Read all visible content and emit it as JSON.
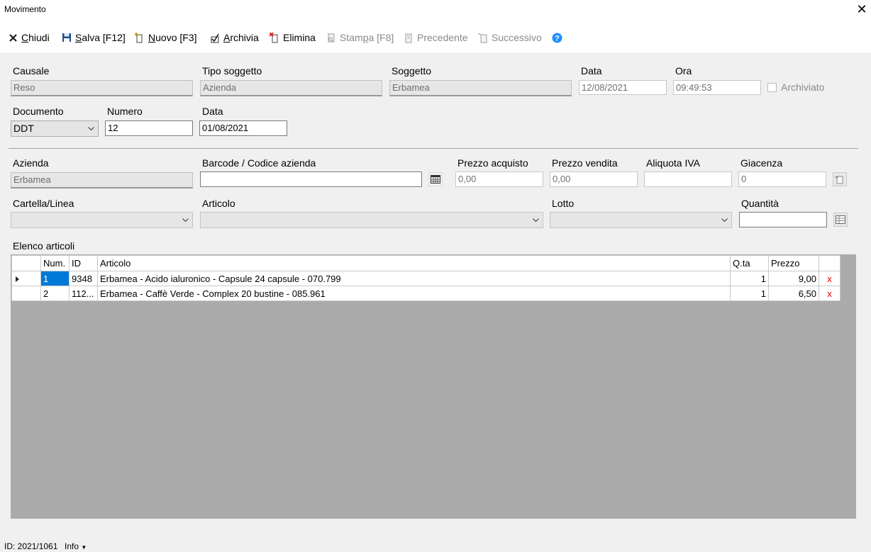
{
  "window": {
    "title": "Movimento"
  },
  "toolbar": {
    "chiudi": {
      "underline": "C",
      "rest": "hiudi"
    },
    "salva": {
      "underline": "S",
      "rest": "alva [F12]"
    },
    "nuovo": {
      "underline": "N",
      "rest": "uovo [F3]"
    },
    "archivia": {
      "underline": "A",
      "rest": "rchivia"
    },
    "elimina": "Elimina",
    "stampa": {
      "pre": "Stam",
      "underline": "p",
      "post": "a [F8]"
    },
    "precedente": "Precedente",
    "successivo": "Successivo"
  },
  "header": {
    "causale": {
      "label": "Causale",
      "value": "Reso"
    },
    "tipo_soggetto": {
      "label": "Tipo soggetto",
      "value": "Azienda"
    },
    "soggetto": {
      "label": "Soggetto",
      "value": "Erbamea"
    },
    "data": {
      "label": "Data",
      "value": "12/08/2021"
    },
    "ora": {
      "label": "Ora",
      "value": "09:49:53"
    },
    "archiviato": {
      "label": "Archiviato",
      "checked": false
    },
    "documento": {
      "label": "Documento",
      "value": "DDT"
    },
    "numero": {
      "label": "Numero",
      "value": "12"
    },
    "data_doc": {
      "label": "Data",
      "value": "01/08/2021"
    }
  },
  "article": {
    "azienda": {
      "label": "Azienda",
      "value": "Erbamea"
    },
    "barcode": {
      "label": "Barcode / Codice azienda",
      "value": ""
    },
    "prezzo_acquisto": {
      "label": "Prezzo acquisto",
      "value": "0,00"
    },
    "prezzo_vendita": {
      "label": "Prezzo vendita",
      "value": "0,00"
    },
    "aliquota_iva": {
      "label": "Aliquota IVA",
      "value": ""
    },
    "giacenza": {
      "label": "Giacenza",
      "value": "0"
    },
    "cartella": {
      "label": "Cartella/Linea",
      "value": ""
    },
    "articolo": {
      "label": "Articolo",
      "value": ""
    },
    "lotto": {
      "label": "Lotto",
      "value": ""
    },
    "quantita": {
      "label": "Quantità",
      "value": ""
    }
  },
  "list": {
    "title": "Elenco articoli",
    "columns": {
      "num": "Num.",
      "id": "ID",
      "articolo": "Articolo",
      "qta": "Q.ta",
      "prezzo": "Prezzo"
    },
    "rows": [
      {
        "num": "1",
        "id": "9348",
        "articolo": "Erbamea - Acido ialuronico - Capsule 24 capsule - 070.799",
        "qta": "1",
        "prezzo": "9,00",
        "del": "x"
      },
      {
        "num": "2",
        "id": "112...",
        "articolo": "Erbamea - Caffè Verde - Complex 20  bustine - 085.961",
        "qta": "1",
        "prezzo": "6,50",
        "del": "x"
      }
    ]
  },
  "status": {
    "id_text": "ID: 2021/1061",
    "info": "Info"
  },
  "colors": {
    "selection": "#0078d7",
    "grid_bg": "#ababab",
    "delete": "#e00000",
    "help": "#1e90ff"
  }
}
